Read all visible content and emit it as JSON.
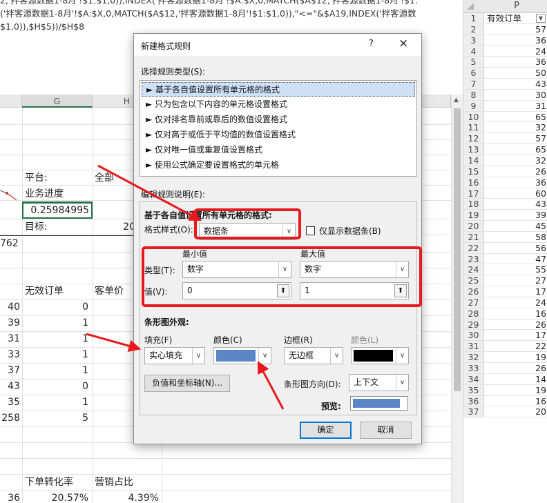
{
  "formula": {
    "line1": "2,'拌客源数据1-8月'!$1:$1,0)),INDEX('拌客源数据1-8月'!$A:$X,0,MATCH($A$12,'拌客源数据1-8月'!$1:",
    "line2": "('拌客源数据1-8月'!$A:$X,0,MATCH($A$12,'拌客源数据1-8月'!$1:$1,0)),\"<=\"&$A19,INDEX('拌客源数",
    "line3": "$1,0)),$H$5))/$H$8"
  },
  "sheet": {
    "col_g": "G",
    "col_h": "H",
    "platform_label": "平台:",
    "platform_value": "全部",
    "progress_label": "业务进度",
    "progress_value": "0.25984995",
    "target_label": "目标:",
    "target_value": "20",
    "value_762": "762",
    "invalid_orders_label": "无效订单",
    "unit_price_label": "客单价",
    "left_values": [
      "40",
      "39",
      "31",
      "33",
      "37",
      "43",
      "35",
      "258"
    ],
    "g_values": [
      "0",
      "1",
      "1",
      "1",
      "1",
      "0",
      "1",
      "5"
    ],
    "conversion_label": "下单转化率",
    "marketing_label": "营销占比",
    "bottom_left": "36",
    "bottom_g": "20.57%",
    "bottom_h": "4.39%"
  },
  "pcol": {
    "header": "P",
    "first_row_label": "有效订单",
    "filter_icon": "filter-dropdown-icon",
    "rows": [
      {
        "n": "1",
        "v": ""
      },
      {
        "n": "2",
        "v": "57"
      },
      {
        "n": "3",
        "v": "36"
      },
      {
        "n": "4",
        "v": "24"
      },
      {
        "n": "5",
        "v": "36"
      },
      {
        "n": "6",
        "v": "50"
      },
      {
        "n": "7",
        "v": "43"
      },
      {
        "n": "8",
        "v": "30"
      },
      {
        "n": "9",
        "v": "31"
      },
      {
        "n": "10",
        "v": "65"
      },
      {
        "n": "11",
        "v": "32"
      },
      {
        "n": "12",
        "v": "57"
      },
      {
        "n": "13",
        "v": "65"
      },
      {
        "n": "14",
        "v": "32"
      },
      {
        "n": "15",
        "v": "26"
      },
      {
        "n": "16",
        "v": "36"
      },
      {
        "n": "17",
        "v": "60"
      },
      {
        "n": "18",
        "v": "43"
      },
      {
        "n": "19",
        "v": "39"
      },
      {
        "n": "20",
        "v": "45"
      },
      {
        "n": "21",
        "v": "58"
      },
      {
        "n": "22",
        "v": "56"
      },
      {
        "n": "23",
        "v": "47"
      },
      {
        "n": "24",
        "v": "55"
      },
      {
        "n": "25",
        "v": "27"
      },
      {
        "n": "26",
        "v": "17"
      },
      {
        "n": "27",
        "v": "24"
      },
      {
        "n": "28",
        "v": "16"
      },
      {
        "n": "29",
        "v": "26"
      },
      {
        "n": "30",
        "v": "17"
      },
      {
        "n": "31",
        "v": "22"
      },
      {
        "n": "32",
        "v": "19"
      },
      {
        "n": "33",
        "v": "26"
      },
      {
        "n": "34",
        "v": "14"
      },
      {
        "n": "35",
        "v": "19"
      },
      {
        "n": "36",
        "v": "16"
      },
      {
        "n": "37",
        "v": "20"
      }
    ]
  },
  "dialog": {
    "title": "新建格式规则",
    "help": "?",
    "close": "×",
    "select_type_label": "选择规则类型(S):",
    "rule_types": [
      "► 基于各自值设置所有单元格的格式",
      "► 只为包含以下内容的单元格设置格式",
      "► 仅对排名靠前或靠后的数值设置格式",
      "► 仅对高于或低于平均值的数值设置格式",
      "► 仅对唯一值或重复值设置格式",
      "► 使用公式确定要设置格式的单元格"
    ],
    "edit_desc_label": "编辑规则说明(E):",
    "section_title": "基于各自值设置所有单元格的格式:",
    "format_style_label": "格式样式(O):",
    "format_style_value": "数据条",
    "show_bar_only_label": "仅显示数据条(B)",
    "min_label": "最小值",
    "max_label": "最大值",
    "type_label": "类型(T):",
    "min_type": "数字",
    "max_type": "数字",
    "value_label": "值(V):",
    "min_value": "0",
    "max_value": "1",
    "bar_appearance": "条形图外观:",
    "fill_label": "填充(F)",
    "color_label": "颜色(C)",
    "border_label": "边框(R)",
    "border_color_label": "颜色(L)",
    "fill_value": "实心填充",
    "border_value": "无边框",
    "neg_axis_button": "负值和坐标轴(N)...",
    "direction_label": "条形图方向(D):",
    "direction_value": "上下文",
    "preview_label": "预览:",
    "ok": "确定",
    "cancel": "取消",
    "fill_color": "#5b86c5",
    "border_color": "#000000"
  }
}
